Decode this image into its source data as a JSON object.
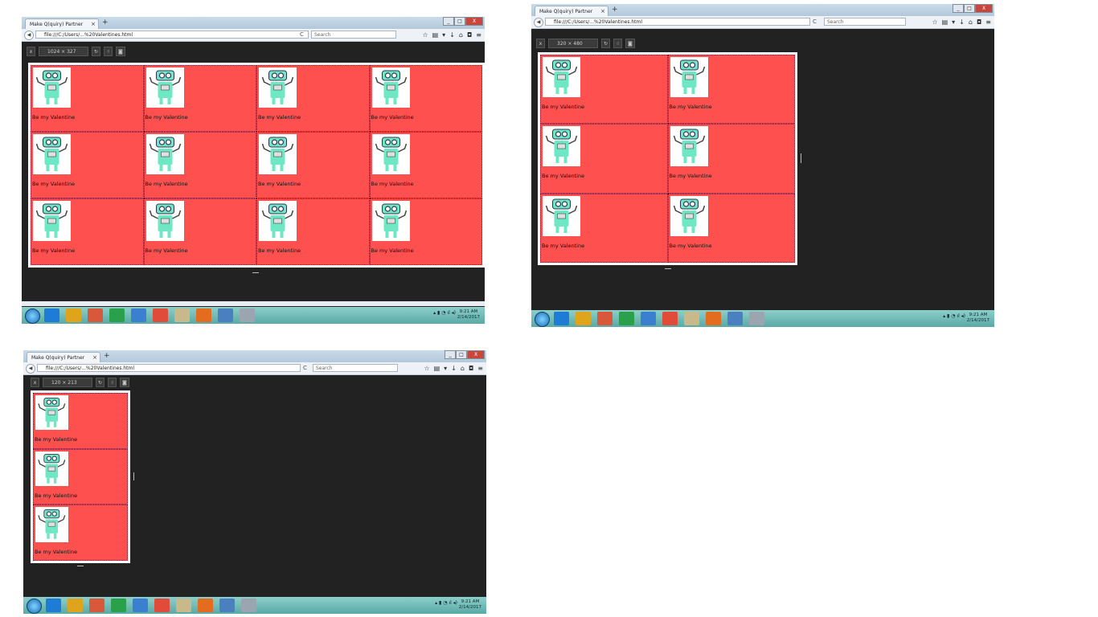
{
  "browser": {
    "tab_title": "Make Q(quiry) Partner",
    "url": "file:///C:/Users/...%20Valentines.html",
    "search_placeholder": "Search",
    "tab_close_glyph": "×",
    "new_tab_glyph": "+",
    "reload_glyph": "C",
    "back_glyph": "◀",
    "window_buttons": [
      "_",
      "□",
      "X"
    ]
  },
  "devtools": {
    "close_glyph": "x",
    "screenshot_icon": "camera-icon",
    "touch_icon": "hand-icon",
    "rotate_icon": "rotate-icon"
  },
  "screens": [
    {
      "id": "large",
      "viewport_label": "1024 × 327",
      "columns": 4,
      "rows": 3
    },
    {
      "id": "medium",
      "viewport_label": "320 × 480",
      "columns": 2,
      "rows": 3
    },
    {
      "id": "small",
      "viewport_label": "120 × 213",
      "columns": 1,
      "rows": 3
    }
  ],
  "card": {
    "caption": "Be my Valentine",
    "image_icon": "robot-icon",
    "card_background": "#ff5050",
    "robot_color": "#6ee8c4"
  },
  "taskbar": {
    "apps": [
      "ie-icon",
      "explorer-icon",
      "media-icon",
      "chart-icon",
      "network-icon",
      "chrome-icon",
      "notepad-icon",
      "firefox-icon",
      "app-icon",
      "app2-icon"
    ],
    "clock_time": "9:21 AM",
    "clock_date": "2/14/2017"
  }
}
